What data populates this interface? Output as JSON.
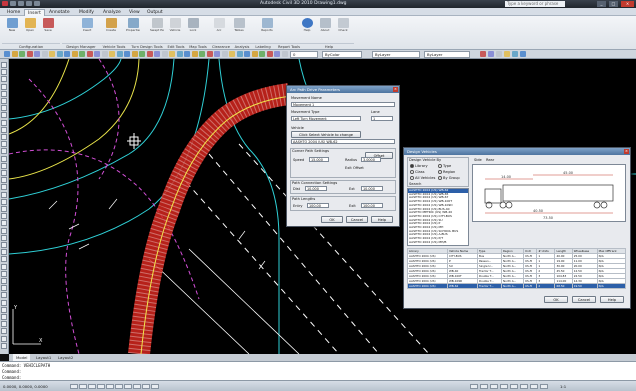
{
  "window": {
    "title": "Autodesk Civil 3D 2010   Drawing1.dwg",
    "search_placeholder": "Type a keyword or phrase"
  },
  "tabs": [
    "Home",
    "Insert",
    "Annotate",
    "Modify",
    "Analyze",
    "View",
    "Output"
  ],
  "ribbon": {
    "buttons": [
      "New",
      "Open",
      "Save",
      "Insert",
      "Create",
      "Properties",
      "Swept Path",
      "Vehicle",
      "Lock",
      "Arc",
      "Tables",
      "Reports",
      "Help",
      "About",
      "Check"
    ],
    "panels": [
      "Configuration",
      "Design Manager",
      "Vehicle Tools",
      "Turn Design Tools",
      "Edit Tools",
      "Map Tools",
      "Clearance",
      "Analysis",
      "Labeling",
      "Report Tools",
      "Help"
    ]
  },
  "toolbar": {
    "layer": "0",
    "linetype": "ByLayer",
    "lineweight": "ByLayer",
    "color": "ByColor"
  },
  "layout_tabs": [
    "Model",
    "Layout1",
    "Layout2"
  ],
  "command": [
    "Command:  VEHICLEPATH",
    "Command:",
    "Command:"
  ],
  "dlg1": {
    "title": "Arc Path Drive Parameters",
    "movement_label": "Movement Name",
    "movement_value": "Movement 1",
    "type_label": "Movement Type",
    "type_value": "Left Turn Movement",
    "lane_label": "Lane",
    "lane_value": "1",
    "vehicle_label": "Vehicle",
    "vehicle_button": "Click Select Vehicle to change",
    "vehicle_value": "AASHTO 2004 (US) WB-62",
    "corner_label": "Corner Path Settings",
    "offset_label": "Offset",
    "radius_label": "Radius",
    "speed_label": "Speed",
    "speed_value": "15.000",
    "radius_value": "3.0000",
    "steer_label": "Exit Offset",
    "conn_label": "Path Connection Settings",
    "dist_label": "Dist",
    "dist_value": "10.000",
    "ext_label": "Ext",
    "ext_value": "10.000",
    "path_label": "Path Lengths",
    "entry_label": "Entry",
    "entry_value": "100.00",
    "exit_label": "Exit",
    "exit_value": "100.00",
    "ok": "OK",
    "cancel": "Cancel",
    "help": "Help"
  },
  "dlg2": {
    "title": "Design Vehicles",
    "group_label": "Design Vehicle By",
    "radios": [
      "Library",
      "Type",
      "Class",
      "Region",
      "All Vehicles",
      "By Group"
    ],
    "search_label": "Search",
    "vehicle_list": [
      "AASHTO 2004 (US) WB-62",
      "AASHTO 2004 (US) WB-65",
      "AASHTO 2004 (US) WB-67",
      "AASHTO 2004 (US) WB-100T",
      "AASHTO 2004 (US) WB-109D",
      "AASHTO 2004 (US) BUS-40",
      "AASHTO METRIC (US) WB-20",
      "AASHTO 2004 (US) CITY-BUS",
      "AASHTO 2004 (US) SU",
      "AASHTO 2004 (US) P",
      "AASHTO 2004 (US) MH",
      "AASHTO 2004 (US) SCHOOL BUS",
      "AASHTO 2004 (US) A-BUS",
      "AASHTO 2004 (US) P/T",
      "AASHTO 2004 (US) MH/B"
    ],
    "dims": {
      "a": "14.00",
      "b": "45.00",
      "c": "40.50",
      "d": "73.50"
    },
    "tab_side": "Side",
    "tab_rear": "Rear",
    "table_header": [
      "Library",
      "Vehicle Name",
      "Type",
      "Region",
      "Unit",
      "# Units",
      "Length",
      "Wheelbase",
      "Max Offtrack"
    ],
    "table_rows": [
      [
        "AASHTO 2004 (US)",
        "CITY-BUS",
        "Bus",
        "North A...",
        "US-ft",
        "1",
        "40.00",
        "25.00",
        "N/A"
      ],
      [
        "AASHTO 2004 (US)",
        "P",
        "Passen...",
        "North A...",
        "US-ft",
        "1",
        "19.00",
        "11.00",
        "N/A"
      ],
      [
        "AASHTO 2004 (US)",
        "SU",
        "Single U...",
        "North A...",
        "US-ft",
        "1",
        "30.00",
        "20.00",
        "N/A"
      ],
      [
        "AASHTO 2004 (US)",
        "WB-40",
        "Tractor T...",
        "North A...",
        "US-ft",
        "2",
        "45.50",
        "12.50",
        "N/A"
      ],
      [
        "AASHTO 2004 (US)",
        "WB-100T",
        "Double T...",
        "North A...",
        "US-ft",
        "3",
        "104.83",
        "22.50",
        "N/A"
      ],
      [
        "AASHTO 2004 (US)",
        "WB-109D",
        "Double T...",
        "North A...",
        "US-ft",
        "3",
        "114.00",
        "14.30",
        "N/A"
      ],
      [
        "AASHTO 2004 (US)",
        "WB-62",
        "Tractor T...",
        "North A...",
        "US-ft",
        "2",
        "68.50",
        "19.50",
        "N/A"
      ]
    ],
    "ok": "OK",
    "cancel": "Cancel",
    "help": "Help"
  },
  "status": {
    "coords": "0.0000, 0.0000, 0.0000",
    "scale": "1:1"
  }
}
